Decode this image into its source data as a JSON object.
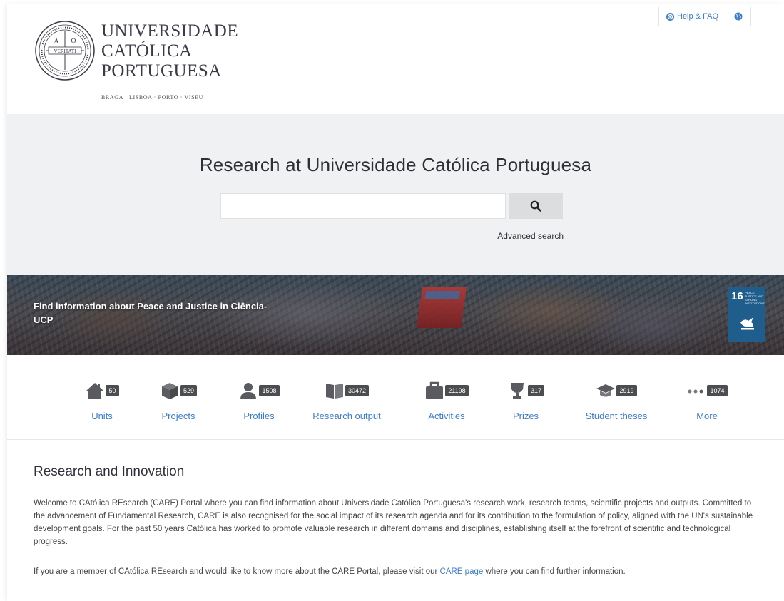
{
  "header": {
    "logo": {
      "line1": "UNIVERSIDADE",
      "line2": "CATÓLICA",
      "line3": "PORTUGUESA",
      "cities": "BRAGA · LISBOA · PORTO · VISEU"
    },
    "help_label": "Help & FAQ"
  },
  "search": {
    "title": "Research at Universidade Católica Portuguesa",
    "input_value": "",
    "advanced_label": "Advanced search"
  },
  "banner": {
    "text": "Find information about Peace and Justice in Ciência-UCP",
    "sdg": {
      "number": "16",
      "caption": "PEACE, JUSTICE AND STRONG INSTITUTIONS"
    }
  },
  "stats": [
    {
      "label": "Units",
      "count": "50",
      "icon": "home-icon"
    },
    {
      "label": "Projects",
      "count": "529",
      "icon": "box-icon"
    },
    {
      "label": "Profiles",
      "count": "1508",
      "icon": "person-icon"
    },
    {
      "label": "Research output",
      "count": "30472",
      "icon": "book-icon"
    },
    {
      "label": "Activities",
      "count": "21198",
      "icon": "briefcase-icon"
    },
    {
      "label": "Prizes",
      "count": "317",
      "icon": "trophy-icon"
    },
    {
      "label": "Student theses",
      "count": "2919",
      "icon": "graduation-cap-icon"
    },
    {
      "label": "More",
      "count": "1074",
      "icon": "more-dots-icon"
    }
  ],
  "content": {
    "title": "Research and Innovation",
    "paragraph1": "Welcome to CAtólica REsearch (CARE) Portal where you can find information about Universidade Católica Portuguesa's research work, research teams, scientific projects and outputs. Committed to the advancement of Fundamental Research, CARE is also recognised for the social impact of its research agenda and for its contribution to the formulation of policy, aligned with the UN's sustainable development goals. For the past 50 years Católica has worked to promote valuable research in different domains and disciplines, establishing itself at the forefront of scientific and technological progress.",
    "paragraph2_before": "If you are a member of CAtólica REsearch and would like to know more about the CARE Portal, please visit our ",
    "paragraph2_link": "CARE page",
    "paragraph2_after": " where you can find further information."
  },
  "colors": {
    "link": "#3d7cc9",
    "search_bg": "#eff1f2",
    "badge": "#4c4d51",
    "sdg": "#1f5d8c"
  }
}
